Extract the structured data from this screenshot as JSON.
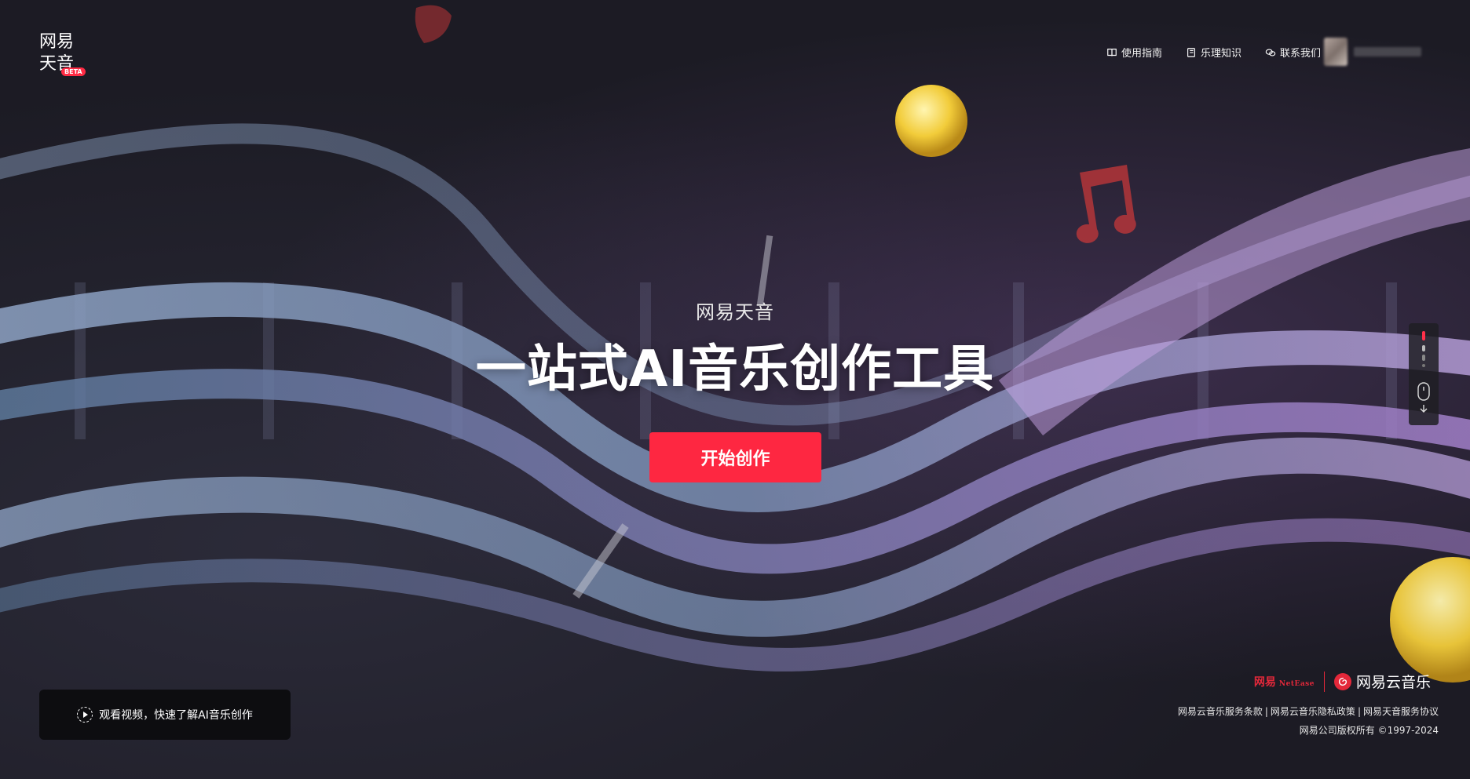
{
  "brand": {
    "logo_line1": "网易",
    "logo_line2": "天音",
    "beta": "BETA"
  },
  "nav": {
    "items": [
      {
        "label": "使用指南",
        "icon": "book-icon"
      },
      {
        "label": "乐理知识",
        "icon": "notebook-icon"
      },
      {
        "label": "联系我们",
        "icon": "chat-icon"
      }
    ]
  },
  "hero": {
    "subtitle": "网易天音",
    "title": "一站式AI音乐创作工具",
    "cta_label": "开始创作"
  },
  "video": {
    "label": "观看视频，快速了解AI音乐创作",
    "icon": "play-circle-icon"
  },
  "footer": {
    "netease_cn": "网易",
    "netease_en": "NetEase",
    "cloudmusic": "网易云音乐",
    "links": [
      "网易云音乐服务条款",
      "网易云音乐隐私政策",
      "网易天音服务协议"
    ],
    "separator": "|",
    "copyright": "网易公司版权所有 ©1997-2024"
  },
  "colors": {
    "accent": "#fe2741",
    "background": "#1c1b24"
  }
}
